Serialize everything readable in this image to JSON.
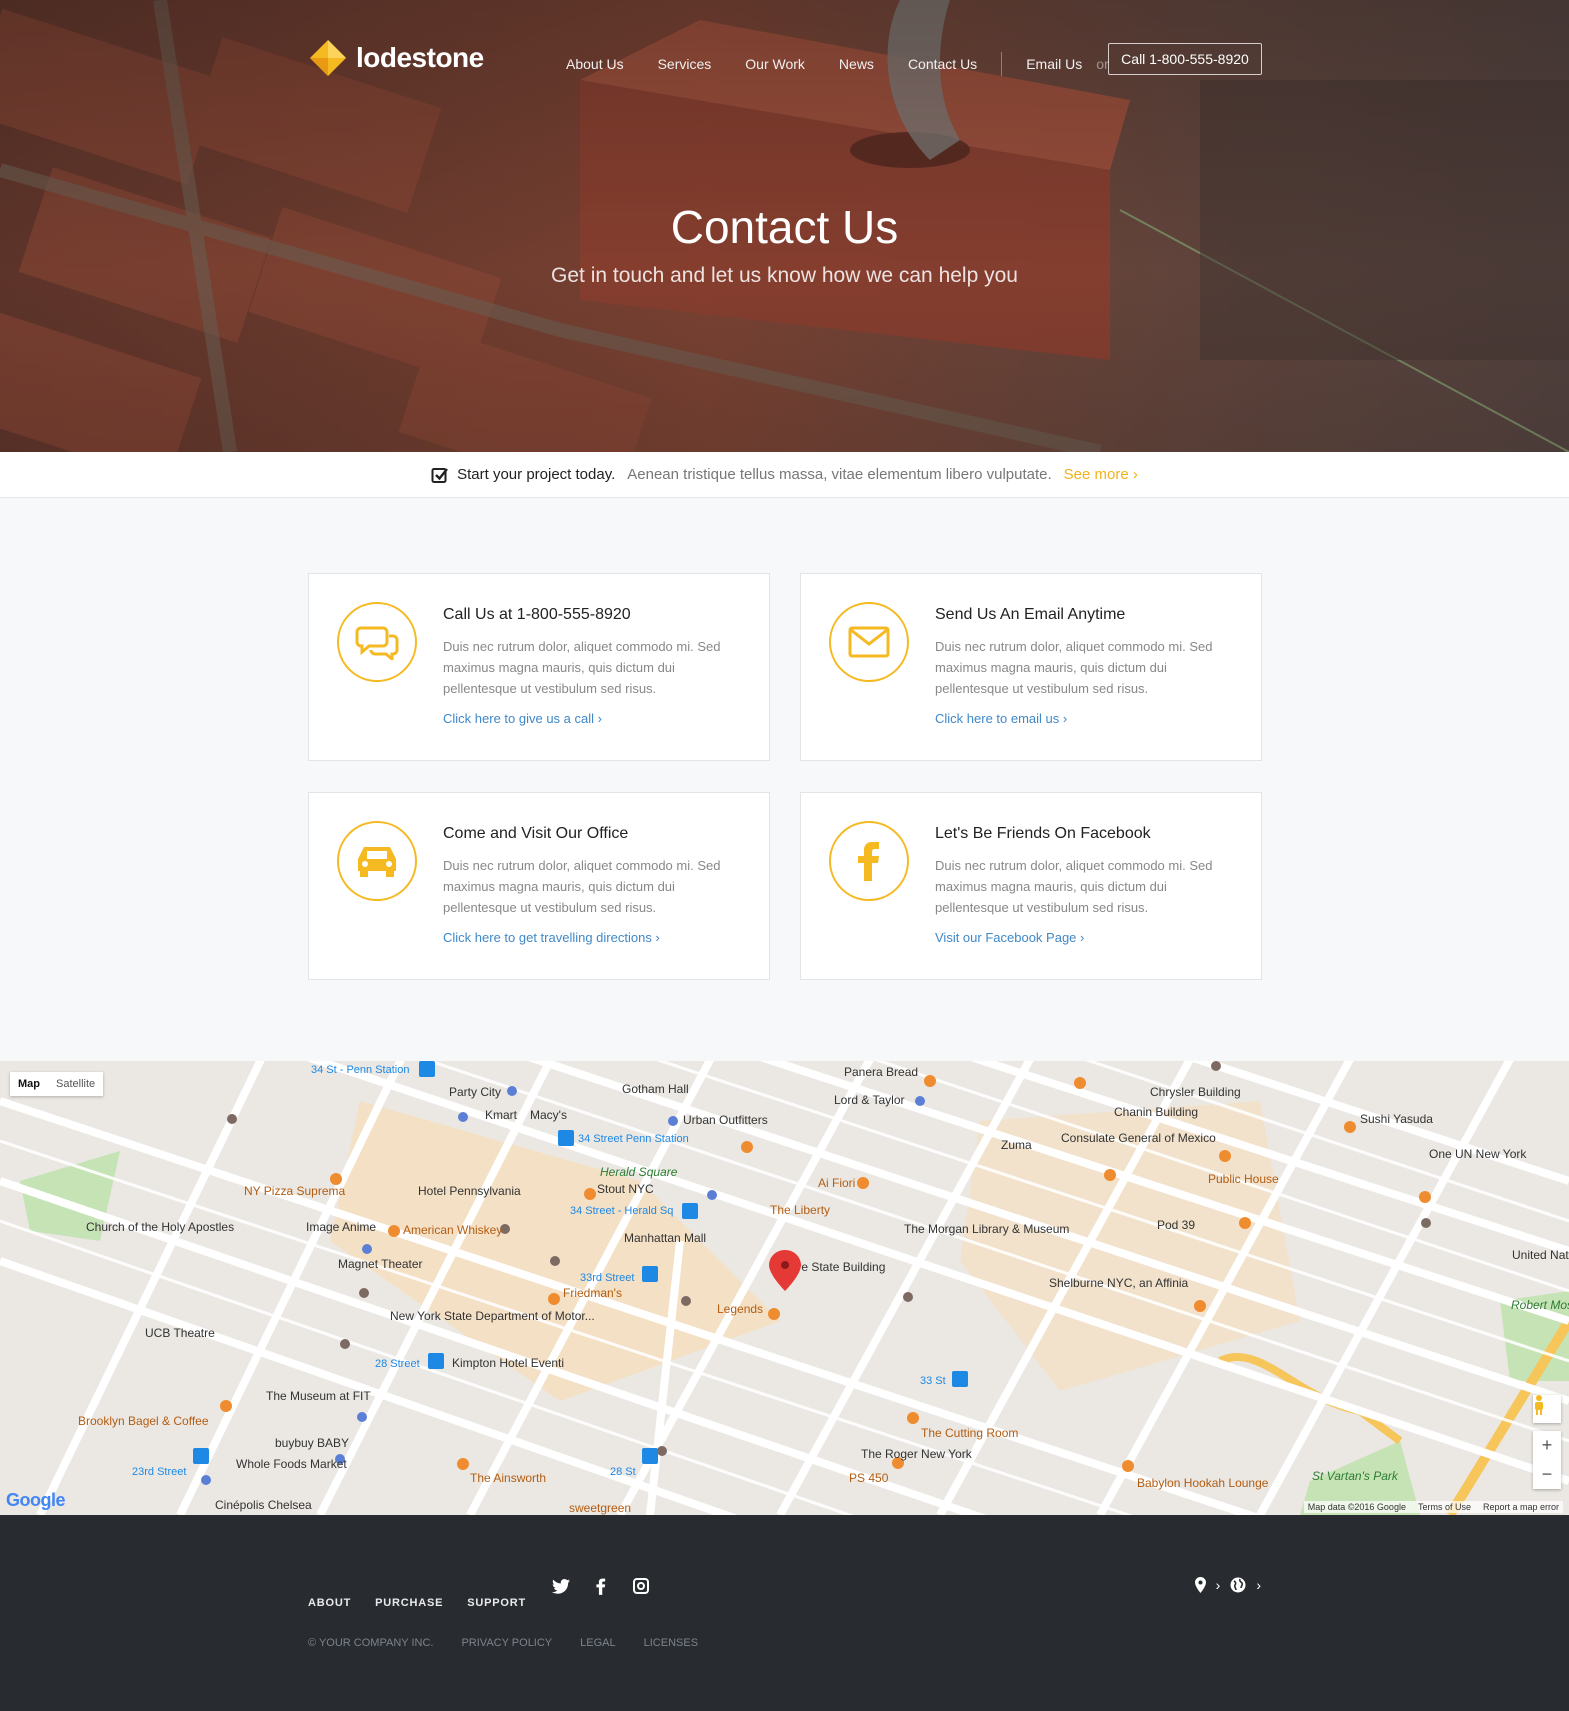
{
  "header": {
    "logo": "lodestone",
    "nav": [
      "About Us",
      "Services",
      "Our Work",
      "News",
      "Contact Us"
    ],
    "email_label": "Email Us",
    "or_label": "or",
    "call_button": "Call 1-800-555-8920"
  },
  "hero": {
    "title": "Contact Us",
    "subtitle": "Get in touch and let us know how we can help you"
  },
  "promo_bar": {
    "lead": "Start your project today.",
    "text": "Aenean tristique tellus massa, vitae elementum libero vulputate.",
    "link": "See more ›"
  },
  "cards": [
    {
      "icon": "chat-icon",
      "title": "Call Us at 1-800-555-8920",
      "desc": "Duis nec rutrum dolor, aliquet commodo mi. Sed maximus magna mauris, quis dictum dui pellentesque ut vestibulum sed risus.",
      "link": "Click here to give us a call ›"
    },
    {
      "icon": "envelope-icon",
      "title": "Send Us An Email Anytime",
      "desc": "Duis nec rutrum dolor, aliquet commodo mi. Sed maximus magna mauris, quis dictum dui pellentesque ut vestibulum sed risus.",
      "link": "Click here to email us ›"
    },
    {
      "icon": "car-icon",
      "title": "Come and Visit Our Office",
      "desc": "Duis nec rutrum dolor, aliquet commodo mi. Sed maximus magna mauris, quis dictum dui pellentesque ut vestibulum sed risus.",
      "link": "Click here to get travelling directions ›"
    },
    {
      "icon": "facebook-icon",
      "title": "Let's Be Friends On Facebook",
      "desc": "Duis nec rutrum dolor, aliquet commodo mi. Sed maximus magna mauris, quis dictum dui pellentesque ut vestibulum sed risus.",
      "link": "Visit our Facebook Page ›"
    }
  ],
  "map": {
    "type_map": "Map",
    "type_satellite": "Satellite",
    "labels": [
      "34 St - Penn Station",
      "Party City",
      "Gotham Hall",
      "Panera Bread",
      "Chrysler Building",
      "Kmart",
      "Macy's",
      "Urban Outfitters",
      "Lord & Taylor",
      "Chanin Building",
      "Sushi Yasuda",
      "34 Street Penn Station",
      "Zuma",
      "Consulate General of Mexico",
      "One UN New York",
      "NY Pizza Suprema",
      "Hotel Pennsylvania",
      "Herald Square",
      "Stout NYC",
      "Ai Fiori",
      "Public House",
      "34 Street - Herald Sq",
      "The Liberty",
      "Church of the Holy Apostles",
      "Image Anime",
      "American Whiskey",
      "Manhattan Mall",
      "The Morgan Library & Museum",
      "Pod 39",
      "United Nations Headquarters",
      "Magnet Theater",
      "Empire State Building",
      "33rd Street",
      "Friedman's",
      "Shelburne NYC, an Affinia",
      "New York State Department of Motor...",
      "Legends",
      "UCB Theatre",
      "Robert Moses Playground",
      "28 Street",
      "Kimpton Hotel Eventi",
      "33 St",
      "The Museum at FIT",
      "Brooklyn Bagel & Coffee",
      "The Cutting Room",
      "buybuy BABY",
      "The Roger New York",
      "Whole Foods Market",
      "23rd Street",
      "The Ainsworth",
      "28 St",
      "PS 450",
      "Babylon Hookah Lounge",
      "St Vartan's Park",
      "Cinépolis Chelsea",
      "sweetgreen"
    ],
    "attribution": [
      "Map data ©2016 Google",
      "Terms of Use",
      "Report a map error"
    ],
    "logo": "Google"
  },
  "footer": {
    "nav": [
      "ABOUT",
      "PURCHASE",
      "SUPPORT"
    ],
    "legal": [
      "© YOUR COMPANY INC.",
      "PRIVACY POLICY",
      "LEGAL",
      "LICENSES"
    ],
    "social": [
      "twitter-icon",
      "facebook-icon",
      "instagram-icon"
    ]
  },
  "colors": {
    "accent": "#f5b921",
    "link": "#3f88c8",
    "footer": "#282c31"
  }
}
